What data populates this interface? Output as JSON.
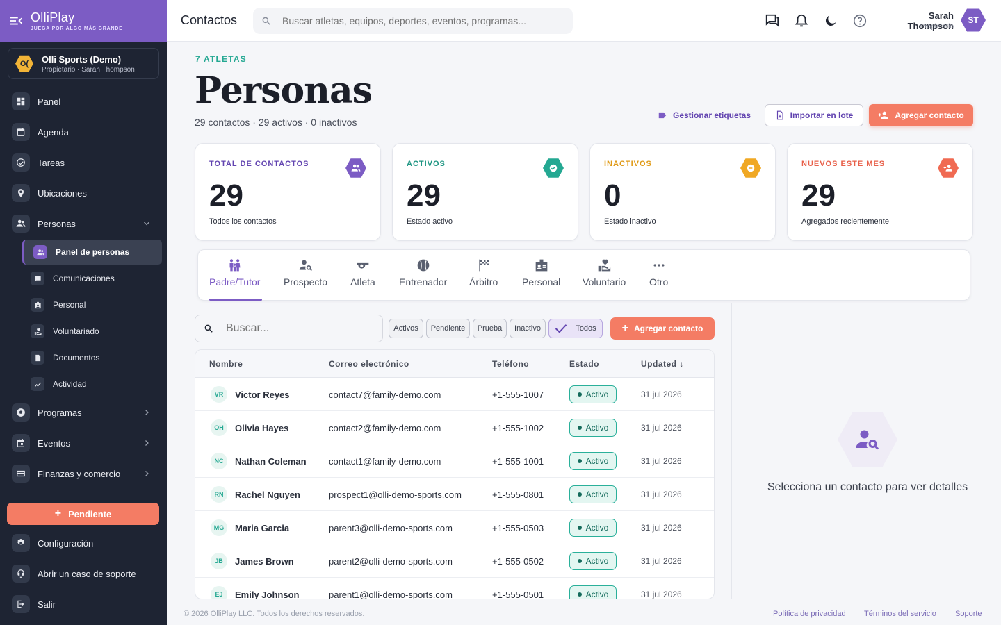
{
  "brand": {
    "name": "OlliPlay",
    "tagline": "JUEGA POR ALGO MÁS GRANDE",
    "color": "#7c5cc4"
  },
  "org": {
    "logo_text": "O(",
    "name": "Olli Sports (Demo)",
    "subtitle": "Propietario · Sarah Thompson"
  },
  "sidebar": {
    "items": [
      {
        "label": "Panel",
        "icon": "dashboard-icon"
      },
      {
        "label": "Agenda",
        "icon": "calendar-icon"
      },
      {
        "label": "Tareas",
        "icon": "check-circle-icon"
      },
      {
        "label": "Ubicaciones",
        "icon": "location-pin-icon"
      },
      {
        "label": "Personas",
        "icon": "people-icon"
      }
    ],
    "sub_items": [
      {
        "label": "Panel de personas",
        "icon": "people-icon"
      },
      {
        "label": "Comunicaciones",
        "icon": "chat-icon"
      },
      {
        "label": "Personal",
        "icon": "badge-icon"
      },
      {
        "label": "Voluntariado",
        "icon": "volunteer-icon"
      },
      {
        "label": "Documentos",
        "icon": "document-icon"
      },
      {
        "label": "Actividad",
        "icon": "activity-icon"
      }
    ],
    "lower_items": [
      {
        "label": "Programas",
        "icon": "ball-icon"
      },
      {
        "label": "Eventos",
        "icon": "event-icon"
      },
      {
        "label": "Finanzas y comercio",
        "icon": "card-icon"
      }
    ],
    "pending_label": "Pendiente",
    "bottom_items": [
      {
        "label": "Configuración",
        "icon": "gear-icon"
      },
      {
        "label": "Abrir un caso de soporte",
        "icon": "support-icon"
      },
      {
        "label": "Salir",
        "icon": "logout-icon"
      }
    ]
  },
  "header": {
    "title": "Contactos",
    "search_placeholder": "Buscar atletas, equipos, deportes, eventos, programas...",
    "user_name": "Sarah Thompson",
    "user_role": "Propietario",
    "avatar_initials": "ST"
  },
  "main": {
    "eyebrow": "7 ATLETAS",
    "title": "Personas",
    "summary": "29 contactos · 29 activos · 0 inactivos",
    "manage_tags": "Gestionar etiquetas",
    "import": "Importar en lote",
    "add_contact": "Agregar contacto"
  },
  "stats": [
    {
      "label": "TOTAL DE CONTACTOS",
      "value": "29",
      "desc": "Todos los contactos",
      "color": "#7c5cc4"
    },
    {
      "label": "ACTIVOS",
      "value": "29",
      "desc": "Estado activo",
      "color": "#24a892"
    },
    {
      "label": "INACTIVOS",
      "value": "0",
      "desc": "Estado inactivo",
      "color": "#f0a824"
    },
    {
      "label": "NUEVOS ESTE MES",
      "value": "29",
      "desc": "Agregados recientemente",
      "color": "#f06a52"
    }
  ],
  "tabs": [
    {
      "label": "Padre/Tutor"
    },
    {
      "label": "Prospecto"
    },
    {
      "label": "Atleta"
    },
    {
      "label": "Entrenador"
    },
    {
      "label": "Árbitro"
    },
    {
      "label": "Personal"
    },
    {
      "label": "Voluntario"
    },
    {
      "label": "Otro"
    }
  ],
  "list": {
    "search_placeholder": "Buscar...",
    "filters": [
      "Activos",
      "Pendiente",
      "Prueba",
      "Inactivo",
      "Todos"
    ],
    "add_contact": "Agregar contacto",
    "columns": [
      "Nombre",
      "Correo electrónico",
      "Teléfono",
      "Estado",
      "Updated"
    ],
    "rows": [
      {
        "initials": "VR",
        "name": "Victor Reyes",
        "email": "contact7@family-demo.com",
        "phone": "+1-555-1007",
        "status": "Activo",
        "updated": "31 jul 2026"
      },
      {
        "initials": "OH",
        "name": "Olivia Hayes",
        "email": "contact2@family-demo.com",
        "phone": "+1-555-1002",
        "status": "Activo",
        "updated": "31 jul 2026"
      },
      {
        "initials": "NC",
        "name": "Nathan Coleman",
        "email": "contact1@family-demo.com",
        "phone": "+1-555-1001",
        "status": "Activo",
        "updated": "31 jul 2026"
      },
      {
        "initials": "RN",
        "name": "Rachel Nguyen",
        "email": "prospect1@olli-demo-sports.com",
        "phone": "+1-555-0801",
        "status": "Activo",
        "updated": "31 jul 2026"
      },
      {
        "initials": "MG",
        "name": "Maria Garcia",
        "email": "parent3@olli-demo-sports.com",
        "phone": "+1-555-0503",
        "status": "Activo",
        "updated": "31 jul 2026"
      },
      {
        "initials": "JB",
        "name": "James Brown",
        "email": "parent2@olli-demo-sports.com",
        "phone": "+1-555-0502",
        "status": "Activo",
        "updated": "31 jul 2026"
      },
      {
        "initials": "EJ",
        "name": "Emily Johnson",
        "email": "parent1@olli-demo-sports.com",
        "phone": "+1-555-0501",
        "status": "Activo",
        "updated": "31 jul 2026"
      }
    ]
  },
  "detail": {
    "empty_text": "Selecciona un contacto para ver detalles"
  },
  "footer": {
    "copyright": "© 2026 OlliPlay LLC. Todos los derechos reservados.",
    "privacy": "Política de privacidad",
    "terms": "Términos del servicio",
    "support": "Soporte"
  }
}
